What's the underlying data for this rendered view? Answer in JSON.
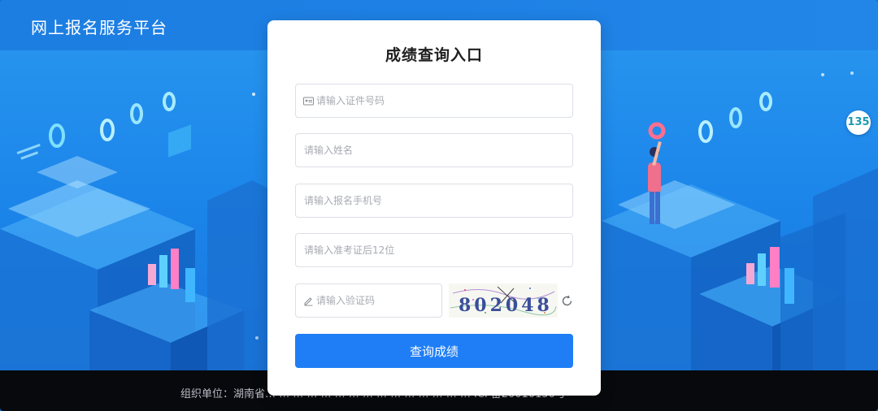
{
  "header": {
    "title": "网上报名服务平台"
  },
  "card": {
    "title": "成绩查询入口",
    "fields": {
      "id_number": {
        "placeholder": "请输入证件号码",
        "value": ""
      },
      "name": {
        "placeholder": "请输入姓名",
        "value": ""
      },
      "phone": {
        "placeholder": "请输入报名手机号",
        "value": ""
      },
      "ticket": {
        "placeholder": "请输入准考证后12位",
        "value": ""
      },
      "captcha": {
        "placeholder": "请输入验证码",
        "value": ""
      }
    },
    "captcha_code": "802048",
    "submit_label": "查询成绩"
  },
  "footer": {
    "text": "组织单位：湖南省… … … … … … … … … … … … … … … ICP备20010150号"
  },
  "badge": {
    "text": "135"
  },
  "colors": {
    "primary": "#1f7ef6",
    "header": "#1e80e4",
    "footer": "#07090d"
  }
}
